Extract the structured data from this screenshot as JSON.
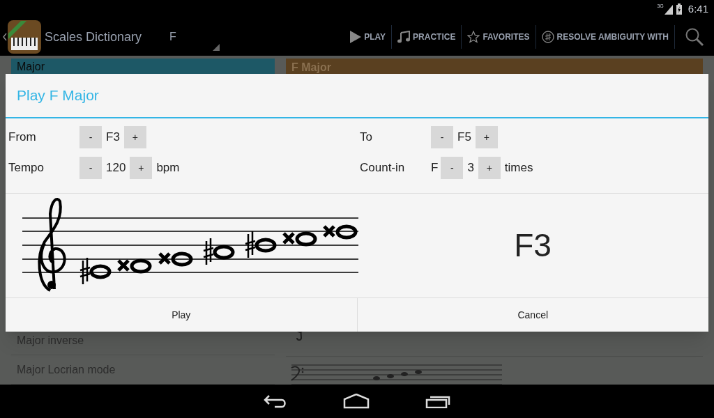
{
  "status_bar": {
    "network": "3G",
    "time": "6:41"
  },
  "action_bar": {
    "title": "Scales Dictionary",
    "spinner_value": "F",
    "actions": [
      "PLAY",
      "PRACTICE",
      "FAVORITES",
      "RESOLVE AMBIGUITY WITH"
    ]
  },
  "scale_list": [
    {
      "label": "Major",
      "selected": true
    },
    {
      "label": "Major inverse",
      "selected": false
    },
    {
      "label": "Major Locrian mode",
      "selected": false
    }
  ],
  "detail": {
    "header": "F Major"
  },
  "dialog": {
    "title": "Play F Major",
    "rows": [
      [
        {
          "label": "From",
          "minus": "-",
          "value": "F3",
          "plus": "+"
        },
        {
          "label": "To",
          "minus": "-",
          "value": "F5",
          "plus": "+"
        }
      ],
      [
        {
          "label": "Tempo",
          "minus": "-",
          "value": "120",
          "plus": "+",
          "unit": "bpm"
        },
        {
          "label": "Count-in",
          "prefix": "F",
          "minus": "-",
          "value": "3",
          "plus": "+",
          "unit": "times"
        }
      ]
    ],
    "current_note": "F3",
    "buttons": [
      "Play",
      "Cancel"
    ]
  }
}
